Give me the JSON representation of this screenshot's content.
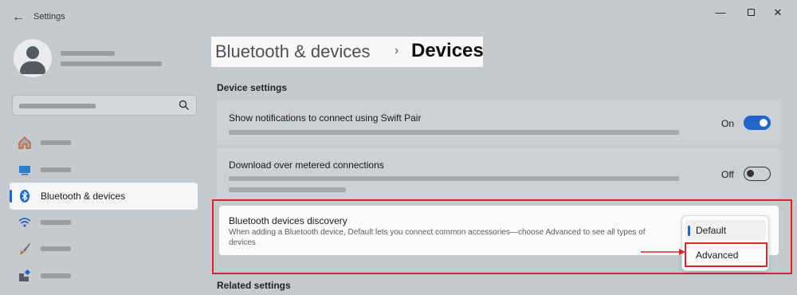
{
  "window": {
    "title": "Settings",
    "back_icon": "←",
    "minimize_icon": "—",
    "close_icon": "✕"
  },
  "sidebar": {
    "items": [
      {
        "icon": "home-icon",
        "label": ""
      },
      {
        "icon": "system-icon",
        "label": ""
      },
      {
        "icon": "bluetooth-icon",
        "label": "Bluetooth & devices",
        "active": true
      },
      {
        "icon": "wifi-icon",
        "label": ""
      },
      {
        "icon": "brush-icon",
        "label": ""
      },
      {
        "icon": "apps-icon",
        "label": ""
      }
    ]
  },
  "header": {
    "parent": "Bluetooth & devices",
    "separator": "›",
    "current": "Devices"
  },
  "sections": {
    "device_settings": "Device settings",
    "related_settings": "Related settings"
  },
  "cards": {
    "swift_pair": {
      "title": "Show notifications to connect using Swift Pair",
      "toggle_label": "On",
      "toggle_state": "on"
    },
    "metered": {
      "title": "Download over metered connections",
      "toggle_label": "Off",
      "toggle_state": "off"
    },
    "discovery": {
      "title": "Bluetooth devices discovery",
      "description": "When adding a Bluetooth device, Default lets you connect common accessories—choose Advanced to see all types of devices"
    }
  },
  "dropdown": {
    "options": [
      "Default",
      "Advanced"
    ],
    "selected": "Default",
    "highlighted": "Advanced"
  },
  "colors": {
    "accent": "#1f66c6",
    "annotation": "#d62828"
  }
}
